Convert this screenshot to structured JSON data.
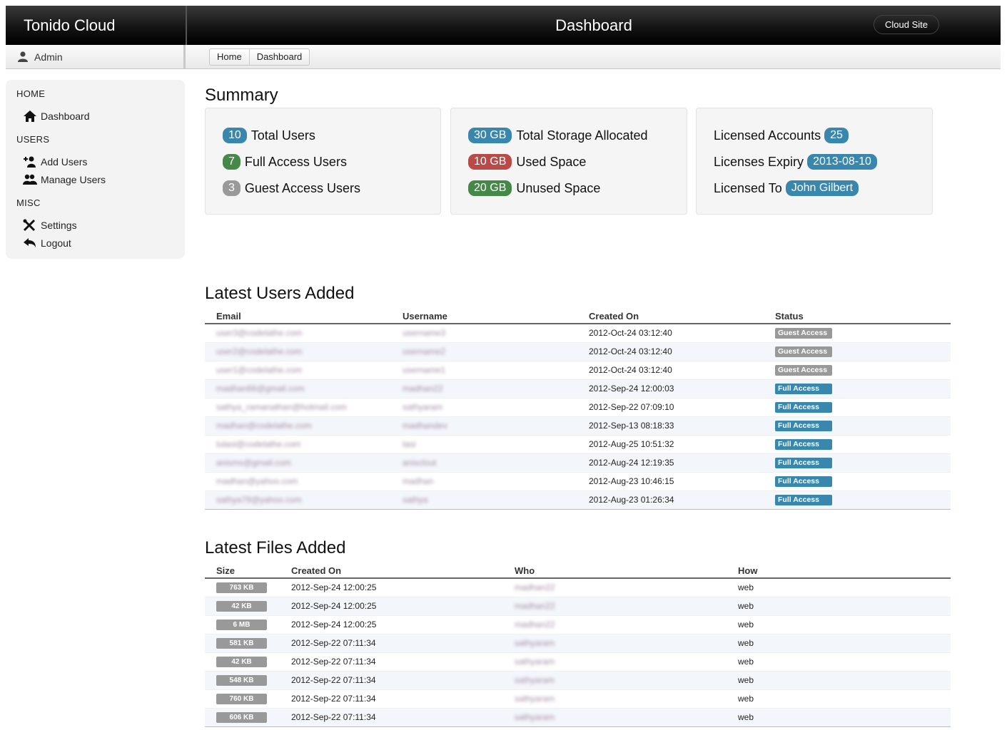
{
  "app": {
    "brand": "Tonido Cloud",
    "page_title": "Dashboard",
    "cloud_site_label": "Cloud Site"
  },
  "user": {
    "name": "Admin"
  },
  "breadcrumb": [
    "Home",
    "Dashboard"
  ],
  "sidebar": {
    "sections": [
      {
        "title": "HOME",
        "items": [
          {
            "label": "Dashboard",
            "icon": "home-icon"
          }
        ]
      },
      {
        "title": "USERS",
        "items": [
          {
            "label": "Add Users",
            "icon": "add-user-icon"
          },
          {
            "label": "Manage Users",
            "icon": "users-icon"
          }
        ]
      },
      {
        "title": "MISC",
        "items": [
          {
            "label": "Settings",
            "icon": "wrench-icon"
          },
          {
            "label": "Logout",
            "icon": "reply-icon"
          }
        ]
      }
    ]
  },
  "summary": {
    "title": "Summary",
    "users": [
      {
        "badge": "10",
        "label": "Total Users",
        "color": "#3a87ad"
      },
      {
        "badge": "7",
        "label": "Full Access Users",
        "color": "#468847"
      },
      {
        "badge": "3",
        "label": "Guest Access Users",
        "color": "#999999"
      }
    ],
    "storage": [
      {
        "badge": "30 GB",
        "label": "Total Storage Allocated",
        "color": "#3a87ad"
      },
      {
        "badge": "10 GB",
        "label": "Used Space",
        "color": "#b94a48"
      },
      {
        "badge": "20 GB",
        "label": "Unused Space",
        "color": "#468847"
      }
    ],
    "license": [
      {
        "label": "Licensed Accounts",
        "badge": "25"
      },
      {
        "label": "Licenses Expiry",
        "badge": "2013-08-10"
      },
      {
        "label": "Licensed To",
        "badge": "John Gilbert"
      }
    ]
  },
  "latest_users": {
    "title": "Latest Users Added",
    "columns": [
      "Email",
      "Username",
      "Created On",
      "Status"
    ],
    "rows": [
      {
        "email": "user3@codelathe.com",
        "username": "username3",
        "created": "2012-Oct-24 03:12:40",
        "status": "Guest Access"
      },
      {
        "email": "user2@codelathe.com",
        "username": "username2",
        "created": "2012-Oct-24 03:12:40",
        "status": "Guest Access"
      },
      {
        "email": "user1@codelathe.com",
        "username": "username1",
        "created": "2012-Oct-24 03:12:40",
        "status": "Guest Access"
      },
      {
        "email": "madhan66@gmail.com",
        "username": "madhan22",
        "created": "2012-Sep-24 12:00:03",
        "status": "Full Access"
      },
      {
        "email": "sathya_ramanathan@hotmail.com",
        "username": "sathyaram",
        "created": "2012-Sep-22 07:09:10",
        "status": "Full Access"
      },
      {
        "email": "madhan@codelathe.com",
        "username": "madhandev",
        "created": "2012-Sep-13 08:18:33",
        "status": "Full Access"
      },
      {
        "email": "tulasi@codelathe.com",
        "username": "tasi",
        "created": "2012-Aug-25 10:51:32",
        "status": "Full Access"
      },
      {
        "email": "anisms@gmail.com",
        "username": "anisclout",
        "created": "2012-Aug-24 12:19:35",
        "status": "Full Access"
      },
      {
        "email": "madhan@yahoo.com",
        "username": "madhan",
        "created": "2012-Aug-23 10:46:15",
        "status": "Full Access"
      },
      {
        "email": "sathya79@yahoo.com",
        "username": "sathya",
        "created": "2012-Aug-23 01:26:34",
        "status": "Full Access"
      }
    ]
  },
  "latest_files": {
    "title": "Latest Files Added",
    "columns": [
      "Size",
      "Created On",
      "Who",
      "How"
    ],
    "rows": [
      {
        "size": "763 KB",
        "created": "2012-Sep-24 12:00:25",
        "who": "madhan22",
        "how": "web"
      },
      {
        "size": "42 KB",
        "created": "2012-Sep-24 12:00:25",
        "who": "madhan22",
        "how": "web"
      },
      {
        "size": "6 MB",
        "created": "2012-Sep-24 12:00:25",
        "who": "madhan22",
        "how": "web"
      },
      {
        "size": "581 KB",
        "created": "2012-Sep-22 07:11:34",
        "who": "sathyaram",
        "how": "web"
      },
      {
        "size": "42 KB",
        "created": "2012-Sep-22 07:11:34",
        "who": "sathyaram",
        "how": "web"
      },
      {
        "size": "548 KB",
        "created": "2012-Sep-22 07:11:34",
        "who": "sathyaram",
        "how": "web"
      },
      {
        "size": "760 KB",
        "created": "2012-Sep-22 07:11:34",
        "who": "sathyaram",
        "how": "web"
      },
      {
        "size": "606 KB",
        "created": "2012-Sep-22 07:11:34",
        "who": "sathyaram",
        "how": "web"
      }
    ]
  }
}
